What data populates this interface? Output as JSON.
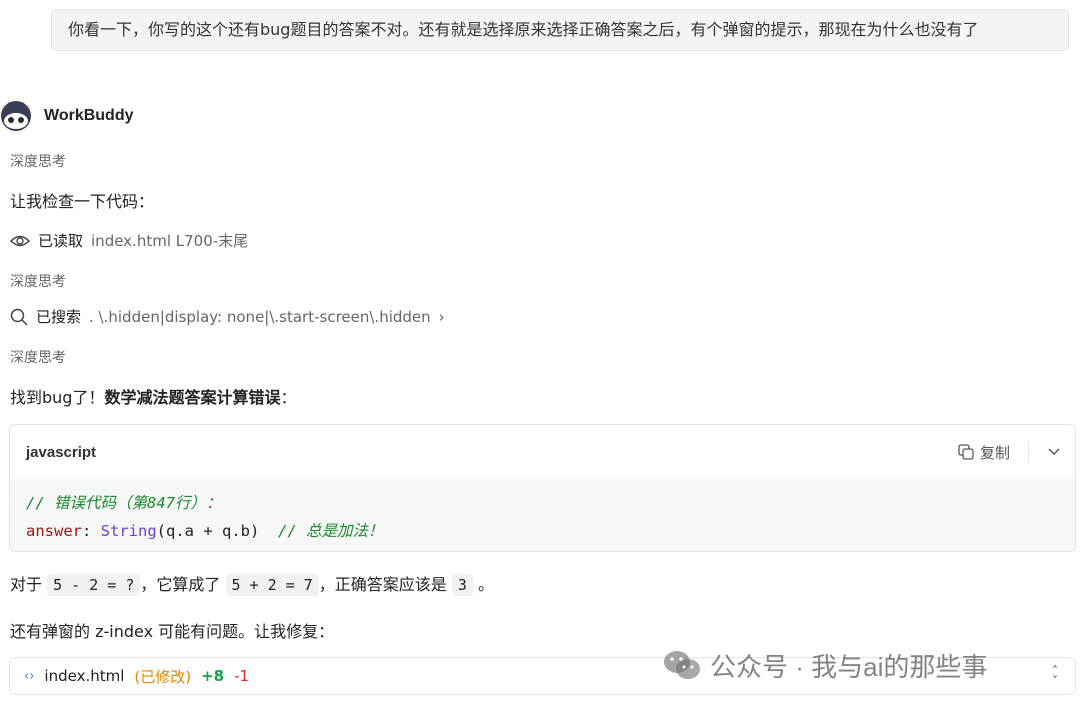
{
  "user_message": "你看一下，你写的这个还有bug题目的答案不对。还有就是选择原来选择正确答案之后，有个弹窗的提示，那现在为什么也没有了",
  "agent": {
    "name": "WorkBuddy"
  },
  "steps": {
    "thinking_1": "深度思考",
    "intro": "让我检查一下代码：",
    "read_label": "已读取",
    "read_arg": "index.html  L700-末尾",
    "thinking_2": "深度思考",
    "search_label": "已搜索",
    "search_arg": ". \\.hidden|display: none|\\.start-screen\\.hidden",
    "thinking_3": "深度思考",
    "found_prefix": "找到bug了！",
    "found_bold": "数学减法题答案计算错误",
    "found_suffix": "："
  },
  "code_block": {
    "lang": "javascript",
    "copy_label": "复制",
    "line1_comment": "// 错误代码（第847行）：",
    "line2_key": "answer",
    "line2_colon": ": ",
    "line2_fn": "String",
    "line2_rest": "(q.a + q.b)  ",
    "line2_comment": "// 总是加法！"
  },
  "explain": {
    "p1_a": "对于",
    "p1_code1": "5 - 2 = ?",
    "p1_b": "，它算成了",
    "p1_code2": "5 + 2 = 7",
    "p1_c": "，正确答案应该是",
    "p1_code3": "3",
    "p1_d": "。",
    "p2": "还有弹窗的 z-index 可能有问题。让我修复："
  },
  "file_change": {
    "filename": "index.html",
    "status": "(已修改)",
    "added": "+8",
    "removed": "-1"
  },
  "watermark": "公众号 · 我与ai的那些事"
}
